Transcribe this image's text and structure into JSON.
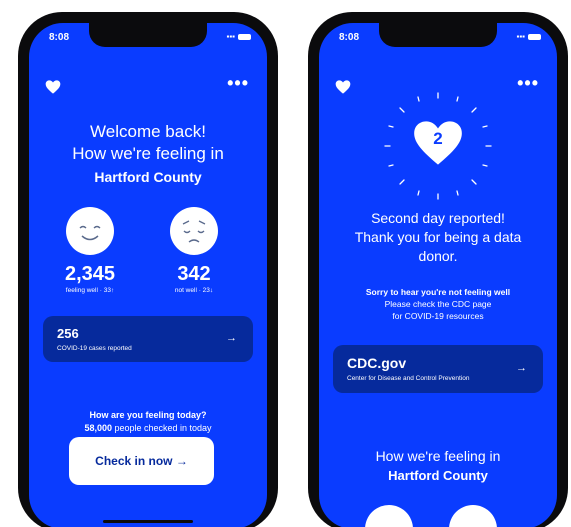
{
  "left_phone": {
    "status": {
      "time": "8:08"
    },
    "header": {
      "menu_label": "•••"
    },
    "welcome": {
      "line1": "Welcome back!",
      "line2": "How we're feeling in",
      "county": "Hartford County"
    },
    "stats": {
      "well": {
        "count": "2,345",
        "label": "feeling well · 33↑"
      },
      "unwell": {
        "count": "342",
        "label": "not well · 23↓"
      }
    },
    "cases_card": {
      "count": "256",
      "label": "COVID-19 cases reported",
      "arrow": "→"
    },
    "prompt": {
      "question": "How are you feeling today?",
      "checked_count": "58,000",
      "checked_text": " people checked in today"
    },
    "checkin_button": {
      "label": "Check in now →"
    }
  },
  "right_phone": {
    "status": {
      "time": "8:08"
    },
    "header": {
      "menu_label": "•••"
    },
    "streak": {
      "day_number": "2"
    },
    "message": {
      "line1": "Second day reported!",
      "line2": "Thank you for being a data",
      "line3": "donor."
    },
    "sorry": {
      "title": "Sorry to hear you're not feeling well",
      "line1": "Please check the CDC page",
      "line2": "for COVID-19 resources"
    },
    "cdc_card": {
      "title": "CDC.gov",
      "subtitle": "Center for Disease and Control Prevention",
      "arrow": "→"
    },
    "feeling": {
      "line1": "How we're feeling in",
      "county": "Hartford County"
    }
  },
  "colors": {
    "background": "#0a3cff",
    "card": "#062a9c",
    "button": "#ffffff",
    "text": "#ffffff"
  },
  "icons": [
    "heart-icon",
    "more-icon",
    "smile-face-icon",
    "sad-face-icon",
    "arrow-right-icon"
  ]
}
